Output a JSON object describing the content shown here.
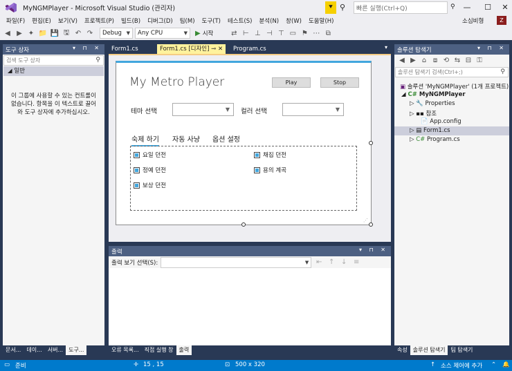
{
  "window": {
    "title": "MyNGMPlayer - Microsoft Visual Studio  (관리자)",
    "quick_launch_placeholder": "빠른 실행(Ctrl+Q)",
    "user": "소심비형",
    "user_badge": "Z"
  },
  "menu": [
    "파일(F)",
    "편집(E)",
    "보기(V)",
    "프로젝트(P)",
    "빌드(B)",
    "디버그(D)",
    "팀(M)",
    "도구(T)",
    "테스트(S)",
    "분석(N)",
    "창(W)",
    "도움말(H)"
  ],
  "toolbar": {
    "config": "Debug",
    "platform": "Any CPU",
    "start_label": "시작"
  },
  "toolbox": {
    "title": "도구 상자",
    "search_placeholder": "검색 도구 상자",
    "group_label": "일반",
    "empty_message": "이 그룹에 사용할 수 있는 컨트롤이 없습니다. 항목을 이 텍스트로 끌어와 도구 상자에 추가하십시오.",
    "bottom_tabs": [
      "문서...",
      "데이...",
      "서버...",
      "도구..."
    ]
  },
  "doc_tabs": [
    "Form1.cs",
    "Form1.cs [디자인]",
    "Program.cs"
  ],
  "form": {
    "title": "My Metro Player",
    "play_label": "Play",
    "stop_label": "Stop",
    "theme_label": "테마 선택",
    "color_label": "컬러 선택",
    "tabs": [
      "숙제 하기",
      "자동 사냥",
      "옵션 설정"
    ],
    "checkboxes": [
      "요일 던전",
      "정예 던전",
      "보상 던전",
      "채집 던전",
      "용의 계곡"
    ]
  },
  "output": {
    "title": "출력",
    "source_label": "출력 보기 선택(S):",
    "bottom_tabs": [
      "오류 목록...",
      "직접 실행 창",
      "출력"
    ]
  },
  "solution": {
    "title": "솔루션 탐색기",
    "search_placeholder": "솔루션 탐색기 검색(Ctrl+;)",
    "items": [
      "솔루션 'MyNGMPlayer' (1개 프로젝트)",
      "MyNGMPlayer",
      "Properties",
      "참조",
      "App.config",
      "Form1.cs",
      "Program.cs"
    ],
    "bottom_tabs": [
      "속성",
      "솔루션 탐색기",
      "팀 탐색기"
    ]
  },
  "status": {
    "ready": "준비",
    "position": "15 , 15",
    "size": "500 x 320",
    "source_control": "소스 제어에 추가"
  }
}
